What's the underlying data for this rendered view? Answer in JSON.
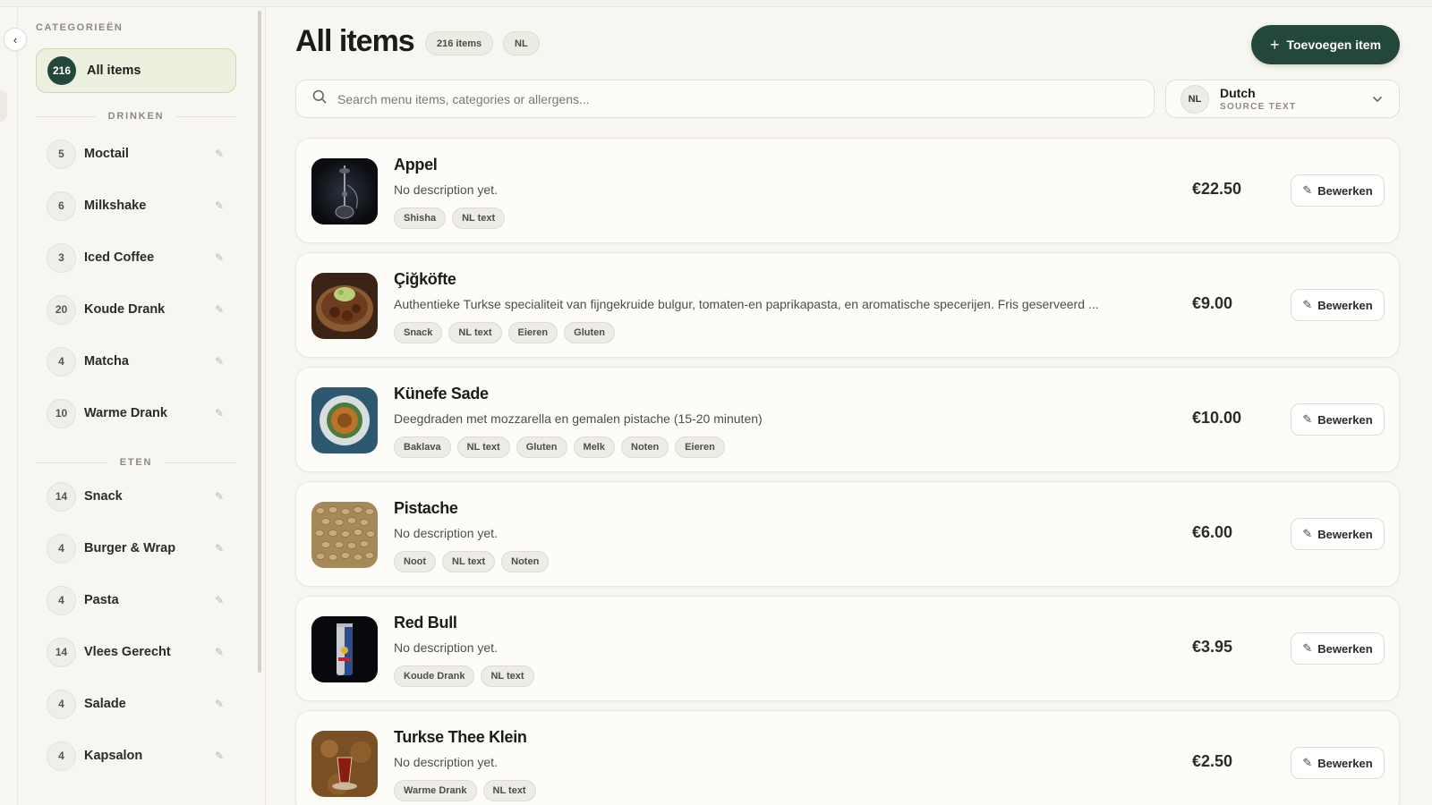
{
  "sidebar": {
    "title": "CATEGORIEËN",
    "all_items": {
      "count": "216",
      "label": "All items"
    },
    "sections": [
      {
        "title": "DRINKEN",
        "items": [
          {
            "count": "5",
            "label": "Moctail"
          },
          {
            "count": "6",
            "label": "Milkshake"
          },
          {
            "count": "3",
            "label": "Iced Coffee"
          },
          {
            "count": "20",
            "label": "Koude Drank"
          },
          {
            "count": "4",
            "label": "Matcha"
          },
          {
            "count": "10",
            "label": "Warme Drank"
          }
        ]
      },
      {
        "title": "ETEN",
        "items": [
          {
            "count": "14",
            "label": "Snack"
          },
          {
            "count": "4",
            "label": "Burger & Wrap"
          },
          {
            "count": "4",
            "label": "Pasta"
          },
          {
            "count": "14",
            "label": "Vlees Gerecht"
          },
          {
            "count": "4",
            "label": "Salade"
          },
          {
            "count": "4",
            "label": "Kapsalon"
          }
        ]
      }
    ]
  },
  "header": {
    "title": "All items",
    "count_pill": "216 items",
    "lang_pill": "NL",
    "add_button": "Toevoegen item"
  },
  "search": {
    "placeholder": "Search menu items, categories or allergens..."
  },
  "language": {
    "code": "NL",
    "name": "Dutch",
    "sub": "SOURCE TEXT"
  },
  "items": [
    {
      "name": "Appel",
      "description": "No description yet.",
      "tags": [
        "Shisha",
        "NL text"
      ],
      "price": "€22.50",
      "edit": "Bewerken",
      "image": "shisha-photo"
    },
    {
      "name": "Çiğköfte",
      "description": "Authentieke Turkse specialiteit van fijngekruide bulgur, tomaten-en paprikapasta, en aromatische specerijen. Fris geserveerd ...",
      "tags": [
        "Snack",
        "NL text",
        "Eieren",
        "Gluten"
      ],
      "price": "€9.00",
      "edit": "Bewerken",
      "image": "cigkofte-photo"
    },
    {
      "name": "Künefe Sade",
      "description": "Deegdraden met mozzarella en gemalen pistache (15-20 minuten)",
      "tags": [
        "Baklava",
        "NL text",
        "Gluten",
        "Melk",
        "Noten",
        "Eieren"
      ],
      "price": "€10.00",
      "edit": "Bewerken",
      "image": "kunefe-photo"
    },
    {
      "name": "Pistache",
      "description": "No description yet.",
      "tags": [
        "Noot",
        "NL text",
        "Noten"
      ],
      "price": "€6.00",
      "edit": "Bewerken",
      "image": "pistachio-photo"
    },
    {
      "name": "Red Bull",
      "description": "No description yet.",
      "tags": [
        "Koude Drank",
        "NL text"
      ],
      "price": "€3.95",
      "edit": "Bewerken",
      "image": "redbull-photo"
    },
    {
      "name": "Turkse Thee Klein",
      "description": "No description yet.",
      "tags": [
        "Warme Drank",
        "NL text"
      ],
      "price": "€2.50",
      "edit": "Bewerken",
      "image": "tea-photo"
    }
  ],
  "colors": {
    "brand": "#23473a",
    "active_bg": "#ecf0df",
    "background": "#f7f6f0"
  }
}
